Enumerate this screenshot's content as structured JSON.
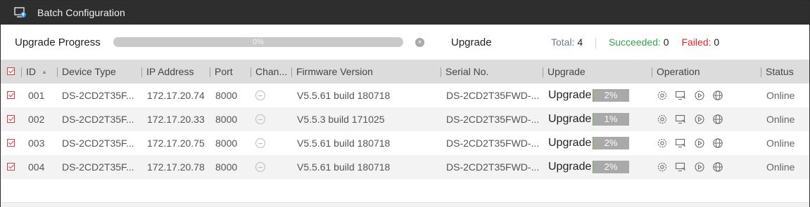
{
  "window": {
    "title": "Batch Configuration"
  },
  "progress": {
    "label": "Upgrade Progress",
    "percent_text": "0%",
    "fraction": 0,
    "upgrade_label": "Upgrade",
    "total_label": "Total:",
    "total": "4",
    "succeeded_label": "Succeeded:",
    "succeeded": "0",
    "failed_label": "Failed:",
    "failed": "0"
  },
  "table": {
    "headers": {
      "id": "ID",
      "device_type": "Device Type",
      "ip": "IP Address",
      "port": "Port",
      "channel": "Chan...",
      "firmware": "Firmware Version",
      "serial": "Serial No.",
      "upgrade": "Upgrade",
      "operation": "Operation",
      "status": "Status"
    },
    "rows": [
      {
        "id": "001",
        "device_type": "DS-2CD2T35F...",
        "ip": "172.17.20.74",
        "port": "8000",
        "firmware": "V5.5.61 build 180718",
        "serial": "DS-2CD2T35FWD-...",
        "upgrade_text": "Upgrade",
        "upgrade_pct": "2%",
        "upgrade_fraction": 0.02,
        "status": "Online"
      },
      {
        "id": "002",
        "device_type": "DS-2CD2T35F...",
        "ip": "172.17.20.33",
        "port": "8000",
        "firmware": "V5.5.3 build 171025",
        "serial": "DS-2CD2T35FWD-...",
        "upgrade_text": "Upgrade",
        "upgrade_pct": "1%",
        "upgrade_fraction": 0.01,
        "status": "Online"
      },
      {
        "id": "003",
        "device_type": "DS-2CD2T35F...",
        "ip": "172.17.20.75",
        "port": "8000",
        "firmware": "V5.5.61 build 180718",
        "serial": "DS-2CD2T35FWD-...",
        "upgrade_text": "Upgrade",
        "upgrade_pct": "2%",
        "upgrade_fraction": 0.02,
        "status": "Online"
      },
      {
        "id": "004",
        "device_type": "DS-2CD2T35F...",
        "ip": "172.17.20.78",
        "port": "8000",
        "firmware": "V5.5.61 build 180718",
        "serial": "DS-2CD2T35FWD-...",
        "upgrade_text": "Upgrade",
        "upgrade_pct": "2%",
        "upgrade_fraction": 0.02,
        "status": "Online"
      }
    ],
    "operation_icons": [
      "gear-icon",
      "remote-config-icon",
      "play-icon",
      "web-icon"
    ]
  },
  "colors": {
    "accent_red": "#e03a3e",
    "success_green": "#2ea44f",
    "progress_green": "#6ab04c"
  }
}
